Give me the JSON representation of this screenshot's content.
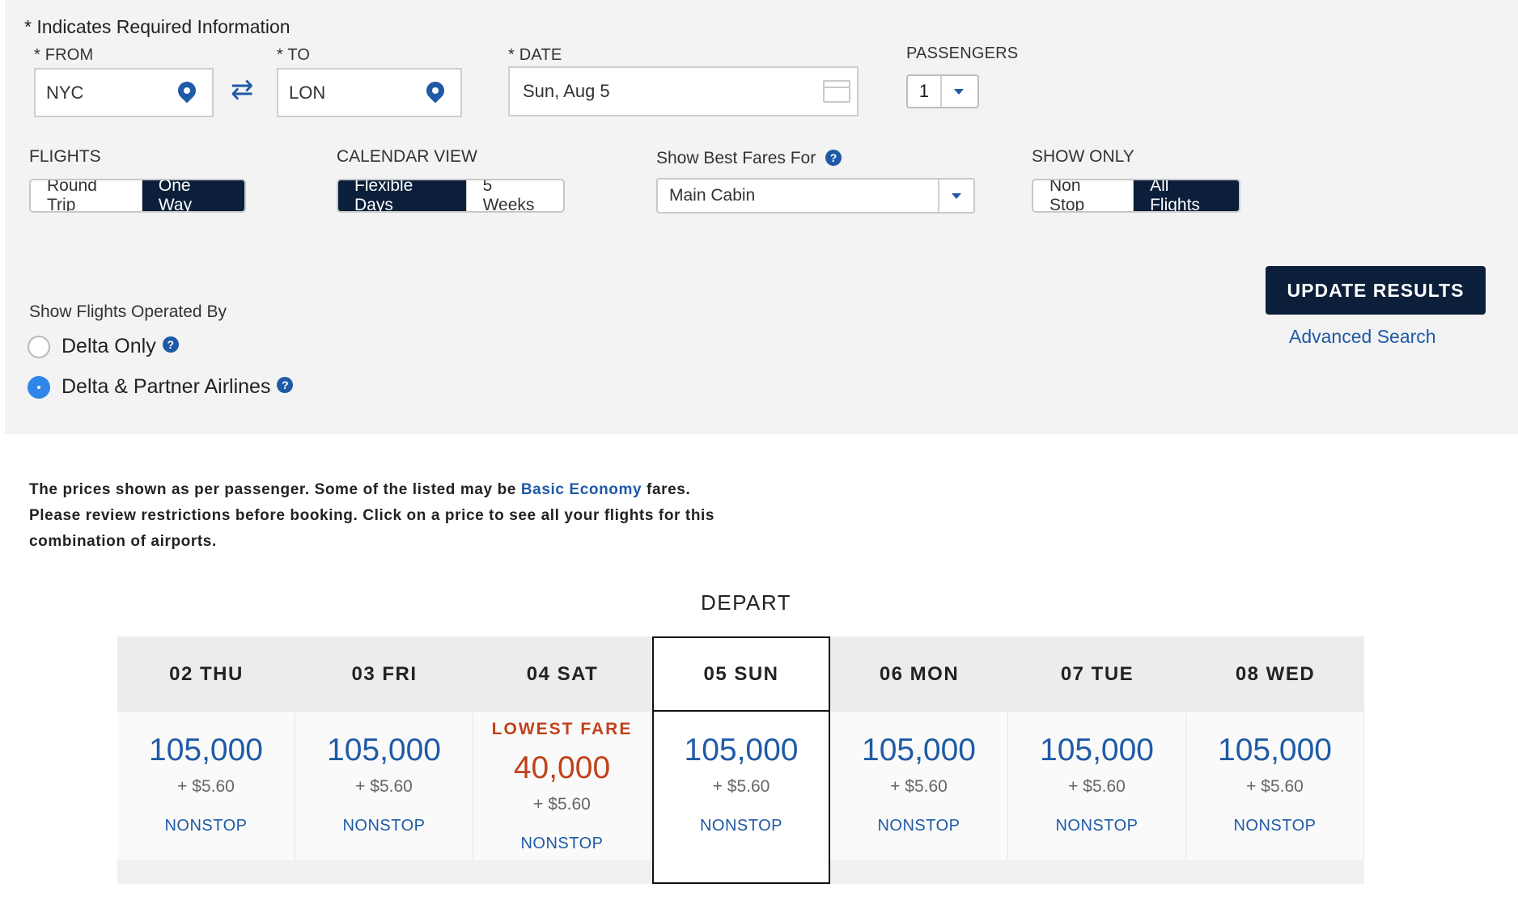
{
  "form": {
    "required_note": "* Indicates Required Information",
    "from": {
      "label": "* FROM",
      "value": "NYC"
    },
    "to": {
      "label": "* TO",
      "value": "LON"
    },
    "date": {
      "label": "* DATE",
      "value": "Sun, Aug 5"
    },
    "passengers": {
      "label": "PASSENGERS",
      "value": "1"
    },
    "flights": {
      "label": "FLIGHTS",
      "options": [
        "Round Trip",
        "One Way"
      ],
      "selected": "One Way"
    },
    "calendar_view": {
      "label": "CALENDAR VIEW",
      "options": [
        "Flexible Days",
        "5 Weeks"
      ],
      "selected": "Flexible Days"
    },
    "best_fares": {
      "label": "Show Best Fares For",
      "value": "Main Cabin"
    },
    "show_only": {
      "label": "SHOW ONLY",
      "options": [
        "Non Stop",
        "All Flights"
      ],
      "selected": "All Flights"
    },
    "operated_by": {
      "label": "Show Flights Operated By",
      "options": [
        "Delta Only",
        "Delta & Partner Airlines"
      ],
      "selected": "Delta & Partner Airlines"
    },
    "update_button": "UPDATE RESULTS",
    "advanced_search": "Advanced Search"
  },
  "notice": {
    "part1": "The prices shown as per passenger. Some of the listed may be ",
    "link": "Basic Economy",
    "part2": " fares.",
    "line2": "Please review restrictions before booking. Click on a price to see all your flights for this",
    "line3": "combination of airports."
  },
  "calendar": {
    "title": "DEPART",
    "days": [
      {
        "label": "02 THU",
        "miles": "105,000",
        "tax": "+ $5.60",
        "stops": "NONSTOP",
        "lowest": "",
        "selected": false
      },
      {
        "label": "03 FRI",
        "miles": "105,000",
        "tax": "+ $5.60",
        "stops": "NONSTOP",
        "lowest": "",
        "selected": false
      },
      {
        "label": "04 SAT",
        "miles": "40,000",
        "tax": "+ $5.60",
        "stops": "NONSTOP",
        "lowest": "LOWEST FARE",
        "selected": false
      },
      {
        "label": "05 SUN",
        "miles": "105,000",
        "tax": "+ $5.60",
        "stops": "NONSTOP",
        "lowest": "",
        "selected": true
      },
      {
        "label": "06 MON",
        "miles": "105,000",
        "tax": "+ $5.60",
        "stops": "NONSTOP",
        "lowest": "",
        "selected": false
      },
      {
        "label": "07 TUE",
        "miles": "105,000",
        "tax": "+ $5.60",
        "stops": "NONSTOP",
        "lowest": "",
        "selected": false
      },
      {
        "label": "08 WED",
        "miles": "105,000",
        "tax": "+ $5.60",
        "stops": "NONSTOP",
        "lowest": "",
        "selected": false
      }
    ]
  }
}
